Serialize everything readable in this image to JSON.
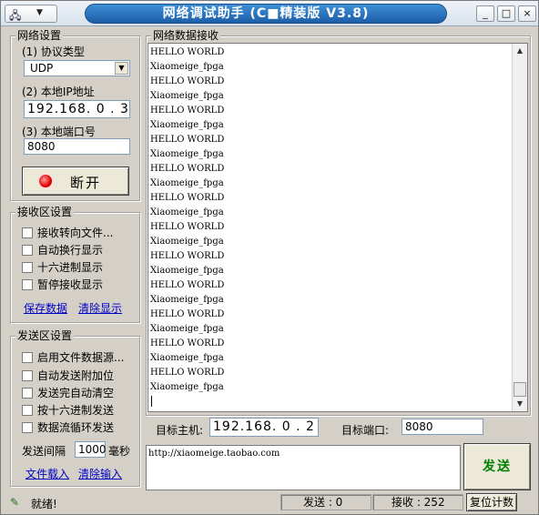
{
  "window": {
    "title": "网络调试助手 (C■精装版 V3.8)",
    "sys_menu_icon": "network-app-icon",
    "controls": {
      "minimize": "_",
      "maximize": "□",
      "close": "×"
    }
  },
  "network_settings": {
    "group_title": "网络设置",
    "protocol_label": "(1) 协议类型",
    "protocol_value": "UDP",
    "local_ip_label": "(2) 本地IP地址",
    "local_ip_value": "192.168. 0 . 3",
    "local_port_label": "(3) 本地端口号",
    "local_port_value": "8080",
    "disconnect_label": "断开"
  },
  "receive_settings": {
    "group_title": "接收区设置",
    "options": [
      "接收转向文件...",
      "自动换行显示",
      "十六进制显示",
      "暂停接收显示"
    ],
    "save_link": "保存数据",
    "clear_link": "清除显示"
  },
  "send_settings": {
    "group_title": "发送区设置",
    "options": [
      "启用文件数据源...",
      "自动发送附加位",
      "发送完自动清空",
      "按十六进制发送",
      "数据流循环发送"
    ],
    "interval_label": "发送间隔",
    "interval_value": "1000",
    "interval_unit": "毫秒",
    "file_load_link": "文件载入",
    "clear_input_link": "清除输入"
  },
  "receive_area": {
    "group_title": "网络数据接收",
    "lines": [
      "HELLO WORLD",
      "Xiaomeige_fpga",
      "HELLO WORLD",
      "Xiaomeige_fpga",
      "HELLO WORLD",
      "Xiaomeige_fpga",
      "HELLO WORLD",
      "Xiaomeige_fpga",
      "HELLO WORLD",
      "Xiaomeige_fpga",
      "HELLO WORLD",
      "Xiaomeige_fpga",
      "HELLO WORLD",
      "Xiaomeige_fpga",
      "HELLO WORLD",
      "Xiaomeige_fpga",
      "HELLO WORLD",
      "Xiaomeige_fpga",
      "HELLO WORLD",
      "Xiaomeige_fpga",
      "HELLO WORLD",
      "Xiaomeige_fpga",
      "HELLO WORLD",
      "Xiaomeige_fpga"
    ]
  },
  "target": {
    "host_label": "目标主机:",
    "host_value": "192.168. 0 . 2",
    "port_label": "目标端口:",
    "port_value": "8080"
  },
  "send_area": {
    "text": "http://xiaomeige.taobao.com",
    "send_label": "发送"
  },
  "status": {
    "ready_text": "就绪!",
    "ready_icon": "pencil-status-icon",
    "send_label": "发送 : 0",
    "recv_label": "接收 : 252",
    "reset_label": "复位计数"
  }
}
